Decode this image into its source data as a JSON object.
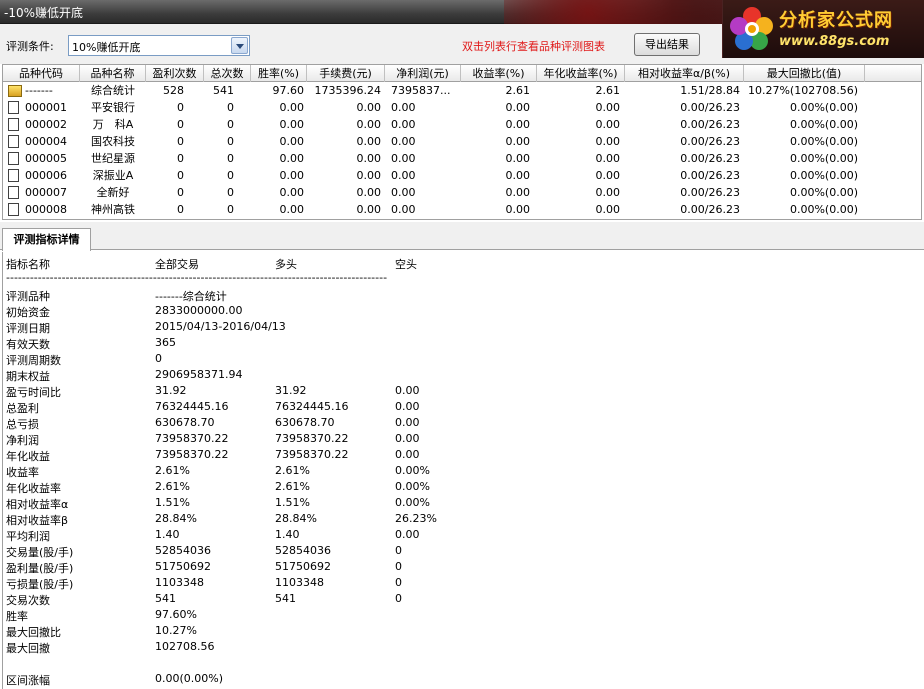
{
  "window": {
    "title": "-10%赚低开底"
  },
  "logo": {
    "name": "分析家公式网",
    "url": "www.88gs.com"
  },
  "toolbar": {
    "condition_label": "评测条件:",
    "condition_value": "10%赚低开底",
    "hint": "双击列表行查看品种评测图表",
    "export_label": "导出结果"
  },
  "table": {
    "headers": [
      "品种代码",
      "品种名称",
      "盈利次数",
      "总次数",
      "胜率(%)",
      "手续费(元)",
      "净利润(元)",
      "收益率(%)",
      "年化收益率(%)",
      "相对收益率α/β(%)",
      "最大回撤比(值)"
    ],
    "rows": [
      [
        "-------",
        "综合统计",
        "528",
        "541",
        "97.60",
        "1735396.24",
        "7395837...",
        "2.61",
        "2.61",
        "1.51/28.84",
        "10.27%(102708.56)"
      ],
      [
        "000001",
        "平安银行",
        "0",
        "0",
        "0.00",
        "0.00",
        "0.00",
        "0.00",
        "0.00",
        "0.00/26.23",
        "0.00%(0.00)"
      ],
      [
        "000002",
        "万　科A",
        "0",
        "0",
        "0.00",
        "0.00",
        "0.00",
        "0.00",
        "0.00",
        "0.00/26.23",
        "0.00%(0.00)"
      ],
      [
        "000004",
        "国农科技",
        "0",
        "0",
        "0.00",
        "0.00",
        "0.00",
        "0.00",
        "0.00",
        "0.00/26.23",
        "0.00%(0.00)"
      ],
      [
        "000005",
        "世纪星源",
        "0",
        "0",
        "0.00",
        "0.00",
        "0.00",
        "0.00",
        "0.00",
        "0.00/26.23",
        "0.00%(0.00)"
      ],
      [
        "000006",
        "深振业A",
        "0",
        "0",
        "0.00",
        "0.00",
        "0.00",
        "0.00",
        "0.00",
        "0.00/26.23",
        "0.00%(0.00)"
      ],
      [
        "000007",
        "全新好",
        "0",
        "0",
        "0.00",
        "0.00",
        "0.00",
        "0.00",
        "0.00",
        "0.00/26.23",
        "0.00%(0.00)"
      ],
      [
        "000008",
        "神州高铁",
        "0",
        "0",
        "0.00",
        "0.00",
        "0.00",
        "0.00",
        "0.00",
        "0.00/26.23",
        "0.00%(0.00)"
      ]
    ]
  },
  "tab": {
    "label": "评测指标详情"
  },
  "details": {
    "headers": [
      "指标名称",
      "全部交易",
      "多头",
      "空头"
    ],
    "separator": "------------------------------------------------------------------------------------------------",
    "rows": [
      [
        "评测品种",
        "-------综合统计",
        "",
        ""
      ],
      [
        "初始资金",
        "2833000000.00",
        "",
        ""
      ],
      [
        "评测日期",
        "2015/04/13-2016/04/13",
        "",
        ""
      ],
      [
        "有效天数",
        "365",
        "",
        ""
      ],
      [
        "评测周期数",
        "0",
        "",
        ""
      ],
      [
        "期末权益",
        "2906958371.94",
        "",
        ""
      ],
      [
        "盈亏时间比",
        "31.92",
        "31.92",
        "0.00"
      ],
      [
        "总盈利",
        "76324445.16",
        "76324445.16",
        "0.00"
      ],
      [
        "总亏损",
        "630678.70",
        "630678.70",
        "0.00"
      ],
      [
        "净利润",
        "73958370.22",
        "73958370.22",
        "0.00"
      ],
      [
        "年化收益",
        "73958370.22",
        "73958370.22",
        "0.00"
      ],
      [
        "收益率",
        "2.61%",
        "2.61%",
        "0.00%"
      ],
      [
        "年化收益率",
        "2.61%",
        "2.61%",
        "0.00%"
      ],
      [
        "相对收益率α",
        "1.51%",
        "1.51%",
        "0.00%"
      ],
      [
        "相对收益率β",
        "28.84%",
        "28.84%",
        "26.23%"
      ],
      [
        "平均利润",
        "1.40",
        "1.40",
        "0.00"
      ],
      [
        "交易量(股/手)",
        "52854036",
        "52854036",
        "0"
      ],
      [
        "盈利量(股/手)",
        "51750692",
        "51750692",
        "0"
      ],
      [
        "亏损量(股/手)",
        "1103348",
        "1103348",
        "0"
      ],
      [
        "交易次数",
        "541",
        "541",
        "0"
      ],
      [
        "胜率",
        "97.60%",
        "",
        ""
      ],
      [
        "最大回撤比",
        "10.27%",
        "",
        ""
      ],
      [
        "最大回撤",
        "102708.56",
        "",
        ""
      ],
      [
        "",
        "",
        "",
        ""
      ],
      [
        "区间涨幅",
        "0.00(0.00%)",
        "",
        ""
      ]
    ]
  }
}
